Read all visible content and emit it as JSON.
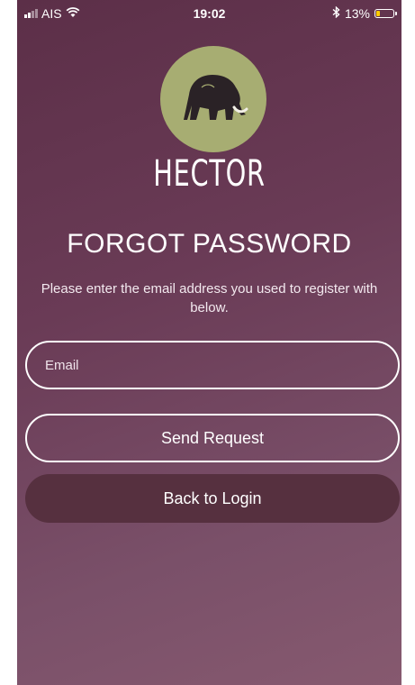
{
  "status_bar": {
    "carrier": "AIS",
    "time": "19:02",
    "battery": "13%",
    "icons": [
      "signal-icon",
      "wifi-icon",
      "bluetooth-icon",
      "battery-icon"
    ]
  },
  "logo": {
    "icon": "mammoth-icon",
    "brand": "HECTOR",
    "circle_color": "#a7ad72"
  },
  "page": {
    "title": "FORGOT PASSWORD",
    "description": "Please enter the email address you used to register with below."
  },
  "form": {
    "email_placeholder": "Email",
    "send_label": "Send Request",
    "back_label": "Back to Login"
  },
  "colors": {
    "background_top": "#5c2f48",
    "background_bottom": "#86596f",
    "back_button": "#56303f"
  }
}
